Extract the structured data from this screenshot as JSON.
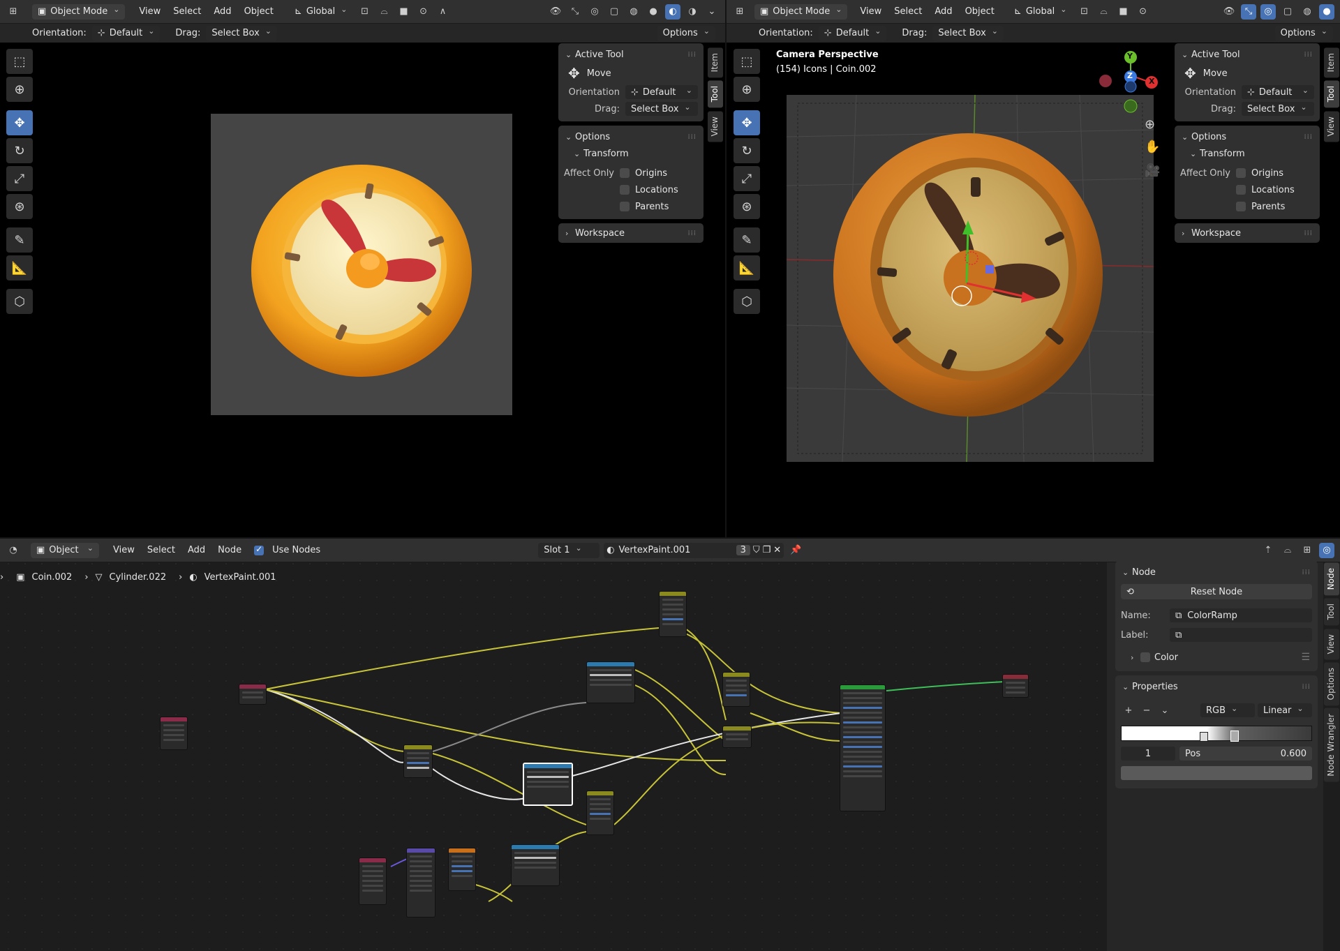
{
  "colors": {
    "accent": "#4772b3",
    "header_bg": "#303030",
    "viewport_bg": "#000000",
    "node_editor_bg": "#1d1d1d",
    "wire_yellow": "#c8c43a",
    "wire_white": "#e6e6e6",
    "wire_grey": "#8a8a8a",
    "wire_green": "#3fbf5a",
    "clock_orange": "#e89a1c",
    "clock_face": "#f1e4b0",
    "clock_hands": "#c9363a"
  },
  "left_viewport": {
    "mode_label": "Object Mode",
    "menus": [
      "View",
      "Select",
      "Add",
      "Object"
    ],
    "transform_orientation": "Global",
    "orientation_label": "Orientation:",
    "orientation_value": "Default",
    "drag_label": "Drag:",
    "drag_value": "Select Box",
    "options_label": "Options"
  },
  "right_viewport": {
    "mode_label": "Object Mode",
    "menus": [
      "View",
      "Select",
      "Add",
      "Object"
    ],
    "transform_orientation": "Global",
    "orientation_label": "Orientation:",
    "orientation_value": "Default",
    "drag_label": "Drag:",
    "drag_value": "Select Box",
    "options_label": "Options",
    "overlay_title": "Camera Perspective",
    "overlay_subtitle": "(154) Icons | Coin.002",
    "gizmo_axes": [
      "Y",
      "Z",
      "X"
    ]
  },
  "npanel": {
    "active_tool_header": "Active Tool",
    "tool_name": "Move",
    "orientation_label": "Orientation",
    "orientation_value": "Default",
    "drag_label": "Drag:",
    "drag_value": "Select Box",
    "options_header": "Options",
    "transform_header": "Transform",
    "affect_only_label": "Affect Only",
    "affect_items": [
      "Origins",
      "Locations",
      "Parents"
    ],
    "workspace_header": "Workspace",
    "tabs": [
      "Item",
      "Tool",
      "View"
    ]
  },
  "node_editor": {
    "editor_type": "Object",
    "menus": [
      "View",
      "Select",
      "Add",
      "Node"
    ],
    "use_nodes_label": "Use Nodes",
    "slot_label": "Slot 1",
    "material_name": "VertexPaint.001",
    "user_count": "3",
    "breadcrumb": [
      "Coin.002",
      "Cylinder.022",
      "VertexPaint.001"
    ]
  },
  "node_sidebar": {
    "node_header": "Node",
    "reset_label": "Reset Node",
    "name_label": "Name:",
    "name_value": "ColorRamp",
    "label_label": "Label:",
    "label_value": "",
    "color_header": "Color",
    "properties_header": "Properties",
    "color_mode": "RGB",
    "interpolation": "Linear",
    "stop_index": "1",
    "pos_label": "Pos",
    "pos_value": "0.600",
    "tabs": [
      "Node",
      "Tool",
      "View",
      "Options",
      "Node Wrangler"
    ]
  }
}
